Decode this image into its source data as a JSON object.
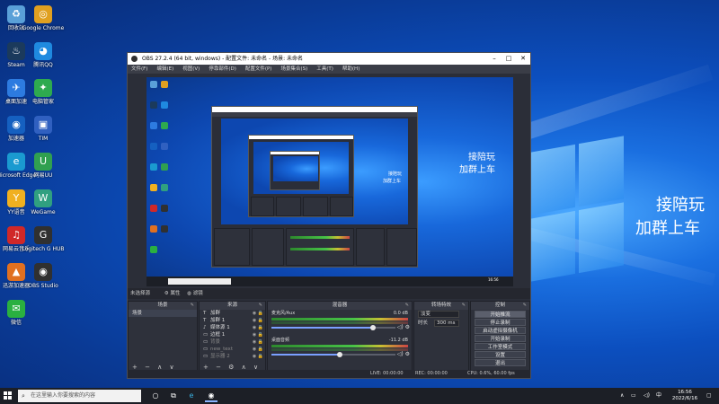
{
  "desktop": {
    "icons": [
      {
        "label": "回收站",
        "icon": "recycle-bin-icon",
        "color": "#5aa0d8"
      },
      {
        "label": "Google Chrome",
        "icon": "chrome-icon",
        "color": "#e0a020"
      },
      {
        "label": "Steam",
        "icon": "steam-icon",
        "color": "#1b3a5c"
      },
      {
        "label": "腾讯QQ",
        "icon": "qq-icon",
        "color": "#1f8ae0"
      },
      {
        "label": "桌面加速",
        "icon": "accelerator-icon",
        "color": "#2d7be0"
      },
      {
        "label": "电脑管家",
        "icon": "pc-manager-icon",
        "color": "#2eaa4f"
      },
      {
        "label": "加速器",
        "icon": "booster-icon",
        "color": "#1560c0"
      },
      {
        "label": "TIM",
        "icon": "tim-icon",
        "color": "#3060c0"
      },
      {
        "label": "Microsoft Edge",
        "icon": "edge-icon",
        "color": "#1a9ad0"
      },
      {
        "label": "网易UU",
        "icon": "uu-icon",
        "color": "#30a050"
      },
      {
        "label": "YY语音",
        "icon": "yy-icon",
        "color": "#f0b020"
      },
      {
        "label": "WeGame",
        "icon": "wegame-icon",
        "color": "#30a080"
      },
      {
        "label": "网易云音乐",
        "icon": "netease-music-icon",
        "color": "#d02828"
      },
      {
        "label": "Logitech G HUB",
        "icon": "logitech-icon",
        "color": "#303030"
      },
      {
        "label": "迅游加速器",
        "icon": "xunyou-icon",
        "color": "#e07020"
      },
      {
        "label": "OBS Studio",
        "icon": "obs-icon",
        "color": "#303030"
      },
      {
        "label": "微信",
        "icon": "wechat-icon",
        "color": "#2ab040"
      }
    ]
  },
  "overlay": {
    "line1": "接陪玩",
    "line2": "加群上车"
  },
  "obs": {
    "title": "OBS 27.2.4 (64 bit, windows) - 配置文件: 未命名 - 场景: 未命名",
    "menu": [
      "文件(F)",
      "编辑(E)",
      "视图(V)",
      "停靠部件(D)",
      "配置文件(P)",
      "场景集合(S)",
      "工具(T)",
      "帮助(H)"
    ],
    "scene_bar": {
      "label": "未选择源",
      "props": "属性",
      "filters": "滤镜"
    },
    "docks": {
      "scenes": {
        "title": "场景",
        "items": [
          "场景"
        ]
      },
      "sources": {
        "title": "来源",
        "items": [
          {
            "icon": "T",
            "name": "加群",
            "visible": true
          },
          {
            "icon": "T",
            "name": "加群 1",
            "visible": true
          },
          {
            "icon": "♪",
            "name": "媒体源 1",
            "visible": true
          },
          {
            "icon": "▭",
            "name": "边框 1",
            "visible": true
          },
          {
            "icon": "▭",
            "name": "背景",
            "visible": false
          },
          {
            "icon": "▭",
            "name": "new_text",
            "visible": false
          },
          {
            "icon": "▭",
            "name": "显示器 2",
            "visible": false
          }
        ]
      },
      "mixer": {
        "title": "混音器",
        "tracks": [
          {
            "name": "麦克风/Aux",
            "db": "0.0 dB",
            "level": 0.82
          },
          {
            "name": "桌面音频",
            "db": "-11.2 dB",
            "level": 0.55
          }
        ]
      },
      "transitions": {
        "title": "转场特效",
        "type_label": "淡变",
        "duration_label": "时长",
        "duration_value": "300 ms"
      },
      "controls": {
        "title": "控制",
        "buttons": [
          "开始推流",
          "停止录制",
          "启动虚拟摄像机",
          "开始录制",
          "工作室模式",
          "设置",
          "退出"
        ]
      }
    },
    "status": {
      "live": "LIVE: 00:00:00",
      "rec": "REC: 00:00:00",
      "cpu": "CPU: 0.6%, 60.00 fps"
    }
  },
  "taskbar": {
    "search_placeholder": "在这里输入你要搜索的内容",
    "time": "16:56",
    "date": "2022/6/16"
  },
  "colors": {
    "accent": "#0c4fbf",
    "obs_bg": "#2b2e38"
  }
}
